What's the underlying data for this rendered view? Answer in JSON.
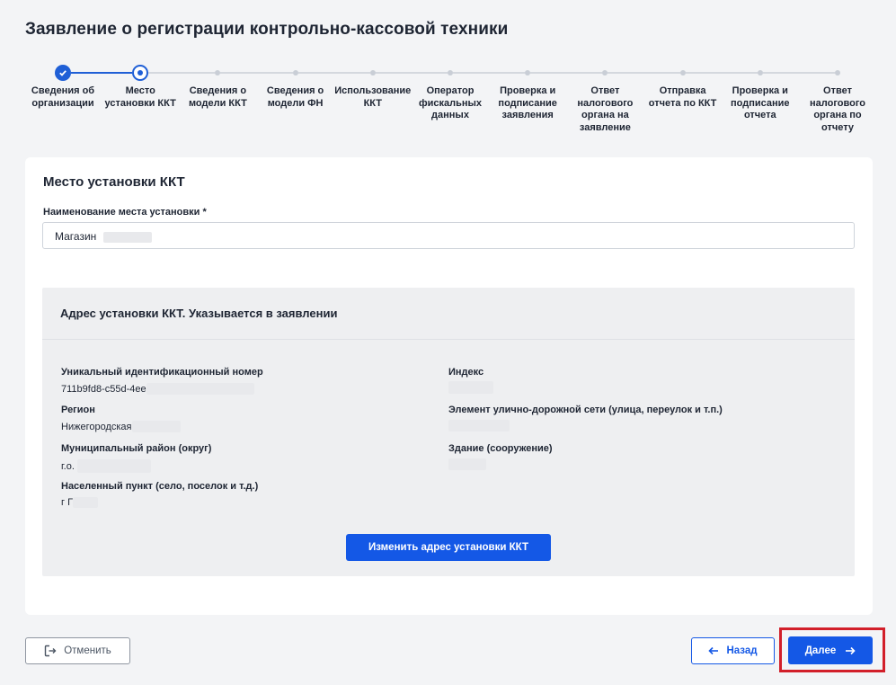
{
  "page": {
    "title": "Заявление о регистрации контрольно-кассовой техники"
  },
  "stepper": {
    "steps": [
      {
        "label": "Сведения об организации",
        "state": "done"
      },
      {
        "label": "Место установки ККТ",
        "state": "current"
      },
      {
        "label": "Сведения о модели ККТ",
        "state": "pending"
      },
      {
        "label": "Сведения о модели ФН",
        "state": "pending"
      },
      {
        "label": "Использование ККТ",
        "state": "pending"
      },
      {
        "label": "Оператор фискальных данных",
        "state": "pending"
      },
      {
        "label": "Проверка и подписание заявления",
        "state": "pending"
      },
      {
        "label": "Ответ налогового органа на заявление",
        "state": "pending"
      },
      {
        "label": "Отправка отчета по ККТ",
        "state": "pending"
      },
      {
        "label": "Проверка и подписание отчета",
        "state": "pending"
      },
      {
        "label": "Ответ налогового органа по отчету",
        "state": "pending"
      }
    ]
  },
  "form": {
    "section_title": "Место установки ККТ",
    "name_field": {
      "label": "Наименование места установки *",
      "value": "Магазин"
    },
    "address": {
      "title": "Адрес установки ККТ. Указывается в заявлении",
      "uid_label": "Уникальный идентификационный номер",
      "uid_value": "711b9fd8-c55d-4ee",
      "region_label": "Регион",
      "region_value": "Нижегородская",
      "district_label": "Муниципальный район (округ)",
      "district_value": "г.о.",
      "settlement_label": "Населенный пункт (село, поселок и т.д.)",
      "settlement_value": "г Г",
      "index_label": "Индекс",
      "street_label": "Элемент улично-дорожной сети (улица, переулок и т.п.)",
      "building_label": "Здание (сооружение)",
      "change_button": "Изменить адрес установки ККТ"
    }
  },
  "footer": {
    "cancel_label": "Отменить",
    "back_label": "Назад",
    "next_label": "Далее"
  },
  "colors": {
    "accent": "#1458e6",
    "highlight": "#d21f2a"
  }
}
